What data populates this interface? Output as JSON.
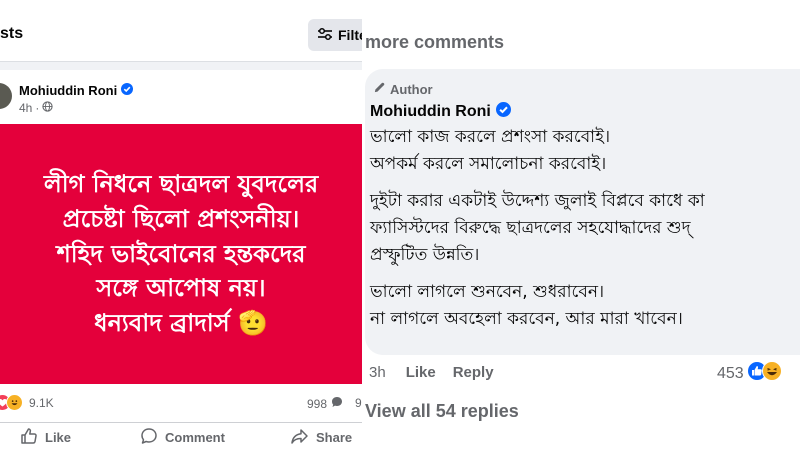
{
  "left_panel": {
    "section_title": "sts",
    "filter_label": "Filte",
    "post": {
      "author": "Mohiuddin Roni",
      "time": "4h",
      "image_text_lines": [
        "লীগ নিধনে ছাত্রদল যুবদলের",
        "প্রচেষ্টা ছিলো প্রশংসনীয়।",
        "শহিদ ভাইবোনের হন্তকদের",
        "সঙ্গে আপোষ নয়।",
        "ধন্যবাদ ব্রাদার্স 🫡"
      ],
      "reaction_count": "9.1K",
      "comment_count": "998",
      "share_count": "9",
      "actions": {
        "like": "Like",
        "comment": "Comment",
        "share": "Share"
      }
    }
  },
  "right_panel": {
    "more_comments": "more comments",
    "comment": {
      "badge": "Author",
      "author": "Mohiuddin Roni",
      "paragraphs": [
        [
          "ভালো কাজ করলে প্রশংসা করবোই।",
          "অপকর্ম করলে সমালোচনা করবোই।"
        ],
        [
          "দুইটা করার একটাই উদ্দেশ্য জুলাই বিপ্লবে কাধে কা",
          "ফ্যাসিস্টদের বিরুদ্ধে ছাত্রদলের সহযোদ্ধাদের শুদ্",
          "প্রস্ফুটিত উন্নতি।"
        ],
        [
          "ভালো লাগলে শুনবেন, শুধরাবেন।",
          "না লাগলে অবহেলা করবেন, আর মারা খাবেন।"
        ]
      ],
      "time": "3h",
      "like_label": "Like",
      "reply_label": "Reply",
      "reaction_count": "453"
    },
    "view_replies": "View all 54 replies"
  },
  "colors": {
    "image_background": "#e4003b",
    "facebook_blue": "#0866ff",
    "secondary_text": "#65676b",
    "bubble_background": "#f0f2f5",
    "panel_background": "#f0f2f5"
  }
}
